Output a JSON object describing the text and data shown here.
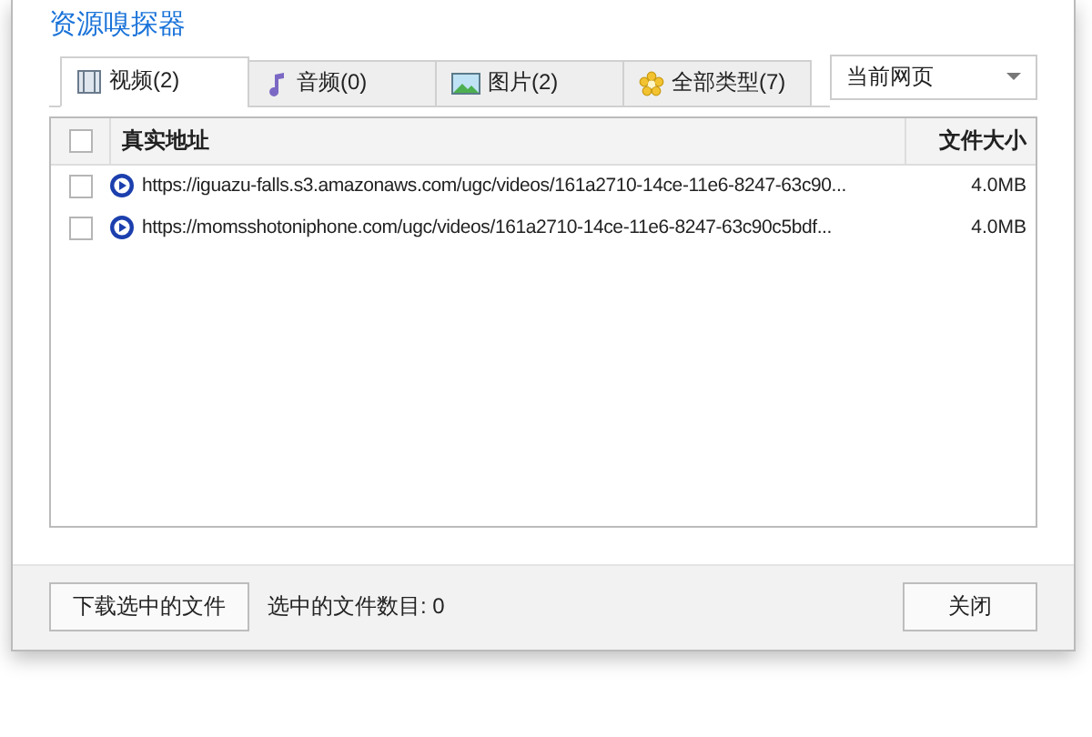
{
  "window": {
    "title": "资源嗅探器"
  },
  "tabs": [
    {
      "label": "视频(2)",
      "kind": "video",
      "selected": true
    },
    {
      "label": "音频(0)",
      "kind": "audio",
      "selected": false
    },
    {
      "label": "图片(2)",
      "kind": "image",
      "selected": false
    },
    {
      "label": "全部类型(7)",
      "kind": "all",
      "selected": false
    }
  ],
  "scope_dropdown": {
    "value": "当前网页"
  },
  "table": {
    "columns": [
      "真实地址",
      "文件大小"
    ],
    "header_checked": false,
    "rows": [
      {
        "checked": false,
        "url": "https://iguazu-falls.s3.amazonaws.com/ugc/videos/161a2710-14ce-11e6-8247-63c90...",
        "size": "4.0MB"
      },
      {
        "checked": false,
        "url": "https://momsshotoniphone.com/ugc/videos/161a2710-14ce-11e6-8247-63c90c5bdf...",
        "size": "4.0MB"
      }
    ]
  },
  "footer": {
    "download_button": "下载选中的文件",
    "selected_count": "选中的文件数目: 0",
    "close_button": "关闭"
  }
}
